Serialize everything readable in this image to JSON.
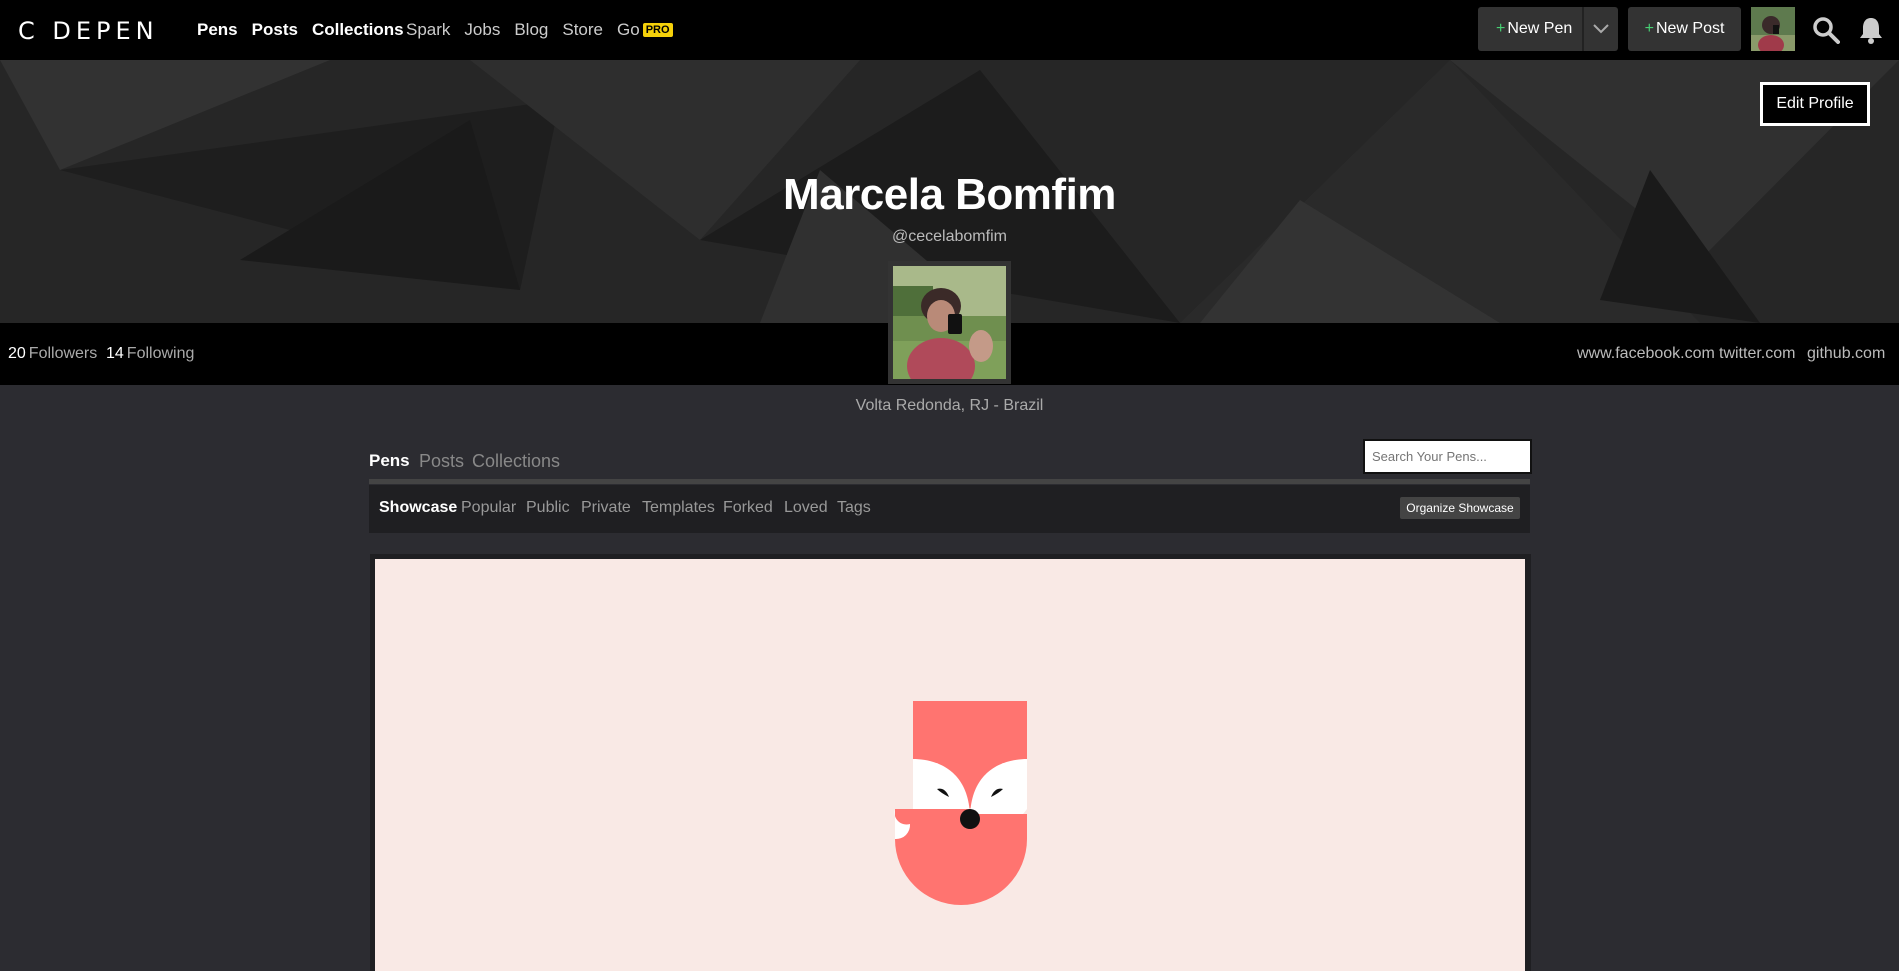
{
  "nav": {
    "logo": "C DEPEN",
    "main_links": [
      "Pens",
      "Posts",
      "Collections"
    ],
    "sub_links": [
      "Spark",
      "Jobs",
      "Blog",
      "Store",
      "Go"
    ],
    "pro_badge": "PRO",
    "new_pen": "New Pen",
    "new_post": "New Post",
    "plus": "+"
  },
  "profile": {
    "edit_label": "Edit Profile",
    "name": "Marcela Bomfim",
    "handle": "@cecelabomfim",
    "followers_count": "20",
    "followers_label": "Followers",
    "following_count": "14",
    "following_label": "Following",
    "social_links": [
      "www.facebook.com",
      "twitter.com",
      "github.com"
    ],
    "location": "Volta Redonda, RJ - Brazil"
  },
  "tabs": [
    "Pens",
    "Posts",
    "Collections"
  ],
  "search": {
    "placeholder": "Search Your Pens..."
  },
  "filters": [
    "Showcase",
    "Popular",
    "Public",
    "Private",
    "Templates",
    "Forked",
    "Loved",
    "Tags"
  ],
  "organize_label": "Organize Showcase",
  "colors": {
    "fox": "#ff7470",
    "preview_bg": "#f9e9e5",
    "pro": "#f5d10a",
    "plus": "#47cf73"
  },
  "icons": [
    "codepen-logo-icon",
    "chevron-down-icon",
    "search-icon",
    "bell-icon"
  ]
}
